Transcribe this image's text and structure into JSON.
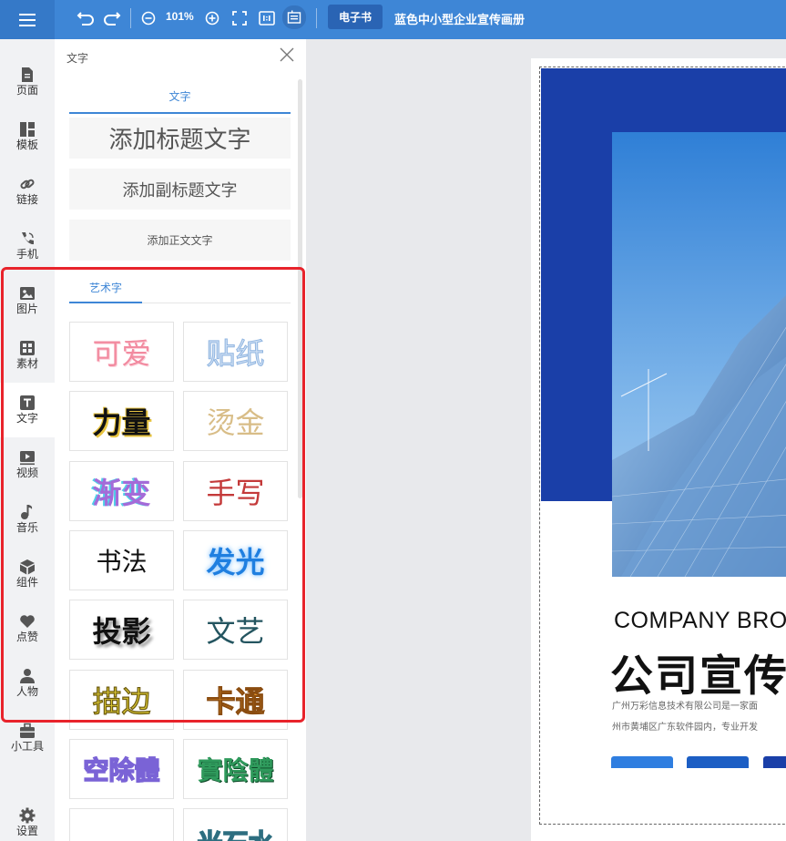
{
  "topbar": {
    "zoom": "101%",
    "ebook_label": "电子书",
    "doc_title": "蓝色中小型企业宣传画册"
  },
  "rail": {
    "items": [
      {
        "label": "页面",
        "icon": "page-icon"
      },
      {
        "label": "模板",
        "icon": "template-icon"
      },
      {
        "label": "链接",
        "icon": "link-icon"
      },
      {
        "label": "手机",
        "icon": "phone-icon"
      },
      {
        "label": "图片",
        "icon": "image-icon"
      },
      {
        "label": "素材",
        "icon": "material-icon"
      },
      {
        "label": "文字",
        "icon": "text-icon"
      },
      {
        "label": "视频",
        "icon": "video-icon"
      },
      {
        "label": "音乐",
        "icon": "music-icon"
      },
      {
        "label": "组件",
        "icon": "component-icon"
      },
      {
        "label": "点赞",
        "icon": "heart-icon"
      },
      {
        "label": "人物",
        "icon": "person-icon"
      },
      {
        "label": "小工具",
        "icon": "toolbox-icon"
      },
      {
        "label": "设置",
        "icon": "gear-icon"
      }
    ]
  },
  "panel": {
    "title": "文字",
    "tab_text": "文字",
    "add_title": "添加标题文字",
    "add_subtitle": "添加副标题文字",
    "add_body": "添加正文文字",
    "tab_art": "艺术字",
    "art_items": [
      "可爱",
      "贴纸",
      "力量",
      "烫金",
      "渐变",
      "手写",
      "书法",
      "发光",
      "投影",
      "文艺",
      "描边",
      "卡通",
      "空除體",
      "實陰體",
      "",
      "光石水"
    ]
  },
  "canvas": {
    "company_en": "COMPANY BRO",
    "company_cn": "公司宣传",
    "body_line_1": "广州万彩信息技术有限公司是一家面",
    "body_line_2": "州市黄埔区广东软件园内，专业开发",
    "brand_blue": "#1a3fa8",
    "accent_blue": "#3e86d6"
  }
}
